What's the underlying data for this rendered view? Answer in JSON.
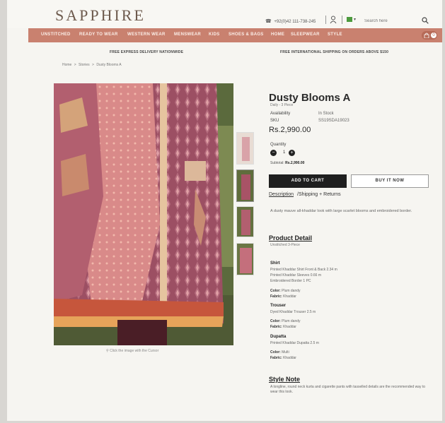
{
  "header": {
    "logo": "SAPPHIRE",
    "phone": "+92(0)42 111-738-245",
    "search_placeholder": "Search here"
  },
  "nav": {
    "items": [
      "UNSTITCHED",
      "READY TO WEAR",
      "WESTERN WEAR",
      "MENSWEAR",
      "KIDS",
      "SHOES & BAGS",
      "HOME",
      "SLEEPWEAR",
      "STYLE"
    ],
    "cart_count": "0"
  },
  "promo": {
    "left": "FREE EXPRESS DELIVERY NATIONWIDE",
    "right": "FREE INTERNATIONAL SHIPPING ON ORDERS ABOVE $150"
  },
  "breadcrumb": [
    "Home",
    ">",
    "Stories",
    ">",
    "Dusty Blooms A"
  ],
  "gallery": {
    "zoom_hint": "Click the image with the Cursor"
  },
  "product": {
    "title": "Dusty Blooms A",
    "subtitle": "Daily - 3 Piece",
    "availability_label": "Availability",
    "availability_value": "In Stock",
    "sku_label": "SKU",
    "sku_value": "SS19SDA19023",
    "price": "Rs.2,990.00",
    "quantity_label": "Quantity",
    "quantity_value": "1",
    "subtotal_label": "Subtotal:",
    "subtotal_value": "Rs.2,990.00",
    "add_to_cart": "ADD TO CART",
    "buy_now": "BUY IT NOW",
    "tab_description": "Description",
    "tab_shipping": "/Shipping + Returns",
    "description": "A dusty mauve all-khaddar look with large scarlet blooms and embroidered border."
  },
  "detail": {
    "heading": "Product Detail",
    "sub": "Unstitched 3-Piece",
    "shirt_title": "Shirt",
    "shirt_lines": [
      "Printed Khaddar Shirt Front & Back 2.34 m",
      "Printed Khaddar Sleeves 0.66 m",
      "Embroidered Border 1 PC"
    ],
    "shirt_color_label": "Color:",
    "shirt_color": "Plum dandy",
    "shirt_fabric_label": "Fabric:",
    "shirt_fabric": "Khaddar",
    "trouser_title": "Trouser",
    "trouser_line": "Dyed Khaddar Trouser 2.5 m",
    "trouser_color_label": "Color:",
    "trouser_color": "Plum dandy",
    "trouser_fabric_label": "Fabric:",
    "trouser_fabric": "Khaddar",
    "dupatta_title": "Dupatta",
    "dupatta_line": "Printed Khaddar Dupatta 2.5 m",
    "dupatta_color_label": "Color:",
    "dupatta_color": "Multi",
    "dupatta_fabric_label": "Fabric:",
    "dupatta_fabric": "Khaddar"
  },
  "style_note": {
    "heading": "Style Note",
    "text": "A longline, round neck kurta and cigarette pants with tasselled details are the recommended way to wear this look."
  },
  "colors": {
    "brand": "#c9816f",
    "logo": "#6d5a4d",
    "fabric": "#a25568",
    "scarf": "#d98a89"
  }
}
